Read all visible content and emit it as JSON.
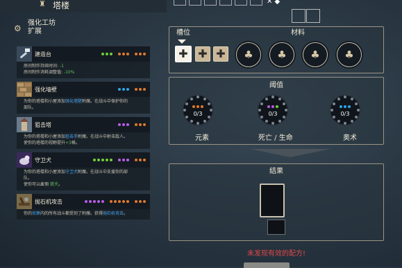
{
  "top": {
    "icon": "tower-icon",
    "title": "塔楼",
    "mark": "✕ ◆"
  },
  "workshop": {
    "icon": "gear-icon",
    "title_line1": "强化工坊",
    "title_line2": "扩展"
  },
  "cards": [
    {
      "title": "建造台",
      "icon": "hammer-icon",
      "dots": [
        "#6fcf3a",
        "#6fcf3a",
        "#6fcf3a",
        "gap",
        "#e07a2c",
        "#e07a2c",
        "#e07a2c",
        "gap",
        "#e07a2c",
        "#e07a2c",
        "#e07a2c"
      ],
      "desc": [
        {
          "text": "房间制作持续时间: "
        },
        {
          "text": "-1",
          "cls": "gr"
        },
        {
          "br": true
        },
        {
          "text": "房间制作消耗调整值: "
        },
        {
          "text": "-10%",
          "cls": "gr"
        }
      ]
    },
    {
      "title": "强化墙壁",
      "icon": "wall-icon",
      "dots": [
        "#2ea5e8",
        "#2ea5e8",
        "#2ea5e8",
        "gap",
        "#e07a2c",
        "#e07a2c",
        "#e07a2c"
      ],
      "desc": [
        {
          "text": "为你的塔楼和小屋添加"
        },
        {
          "text": "强化墙壁",
          "cls": "hl"
        },
        {
          "text": "附魔。在战斗中保护你的"
        },
        {
          "br": true
        },
        {
          "text": "部队。"
        }
      ]
    },
    {
      "title": "狙击塔",
      "icon": "sniper-tower-icon",
      "dots": [
        "#b85ee6",
        "#b85ee6",
        "#b85ee6",
        "gap",
        "#e07a2c",
        "#e07a2c",
        "#e07a2c"
      ],
      "desc": [
        {
          "text": "为你的塔楼和小屋添加"
        },
        {
          "text": "狙击手",
          "cls": "hl"
        },
        {
          "text": "附魔。在战斗中射击敌人。"
        },
        {
          "br": true
        },
        {
          "text": "使你的塔楼的视野提升"
        },
        {
          "text": "+3",
          "cls": "gr"
        },
        {
          "text": "格。"
        }
      ]
    },
    {
      "title": "守卫犬",
      "icon": "guard-dog-icon",
      "dots": [
        "#6fcf3a",
        "#6fcf3a",
        "#6fcf3a",
        "#6fcf3a",
        "#6fcf3a",
        "gap",
        "#b85ee6",
        "#b85ee6",
        "#b85ee6",
        "gap",
        "#e07a2c",
        "#e07a2c",
        "#e07a2c"
      ],
      "desc": [
        {
          "text": "为你的塔楼和小屋添加"
        },
        {
          "text": "守卫犬",
          "cls": "hl"
        },
        {
          "text": "附魔。在战斗中支援你的部"
        },
        {
          "br": true
        },
        {
          "text": "队。"
        },
        {
          "br": true
        },
        {
          "text": "使你可以雇佣 "
        },
        {
          "text": "猎犬",
          "cls": "gr"
        },
        {
          "text": "。"
        }
      ]
    },
    {
      "title": "抛石机攻击",
      "icon": "catapult-icon",
      "dots": [
        "#b85ee6",
        "#b85ee6",
        "#b85ee6",
        "#b85ee6",
        "#b85ee6",
        "gap",
        "#e07a2c",
        "#e07a2c",
        "#e07a2c",
        "#e07a2c",
        "#e07a2c",
        "gap",
        "#e07a2c",
        "#e07a2c",
        "#e07a2c"
      ],
      "desc": [
        {
          "text": "你的"
        },
        {
          "text": "侦察",
          "cls": "hl"
        },
        {
          "text": "内的所有战斗都受到了附魔。获得"
        },
        {
          "text": "抛石机攻击",
          "cls": "hl"
        },
        {
          "text": "。"
        }
      ]
    }
  ],
  "craft": {
    "slots_label": "槽位",
    "materials_label": "材料",
    "slot_icon": "plus-icon",
    "material_icon": "tree-emblem-icon",
    "threshold_label": "阈值",
    "thresholds": [
      {
        "name": "元素",
        "count": "0/3",
        "dots": [
          "#e07a2c",
          "#e07a2c",
          "#e07a2c"
        ]
      },
      {
        "name": "死亡 / 生命",
        "count": "0/3",
        "dots": [
          "#b85ee6",
          "#b85ee6",
          "#6fcf3a"
        ]
      },
      {
        "name": "奥术",
        "count": "0/3",
        "dots": [
          "#2ea5e8",
          "#2ea5e8",
          "#2ea5e8"
        ]
      }
    ],
    "result_label": "结果",
    "error": "未发现有效的配方!"
  }
}
